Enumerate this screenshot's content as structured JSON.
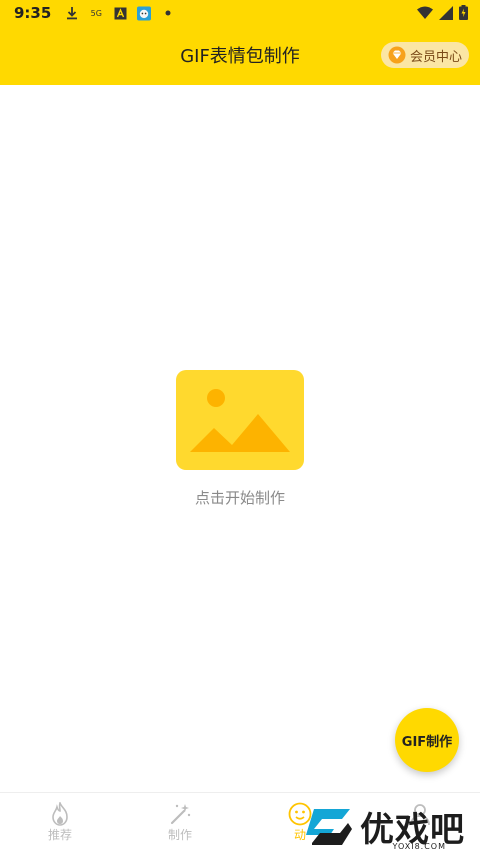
{
  "status_bar": {
    "time": "9:35",
    "network_label": "5G"
  },
  "header": {
    "title": "GIF表情包制作",
    "vip_label": "会员中心"
  },
  "empty_state": {
    "text": "点击开始制作"
  },
  "fab": {
    "label": "GIF制作"
  },
  "tabs": [
    {
      "label": "推荐",
      "icon": "flame-icon",
      "active": false
    },
    {
      "label": "制作",
      "icon": "magic-wand-icon",
      "active": false
    },
    {
      "label": "动",
      "icon": "emoji-face-icon",
      "active": true
    },
    {
      "label": "",
      "icon": "user-icon",
      "active": false
    }
  ],
  "watermark": {
    "text": "优戏吧",
    "sub": "YOXI8.COM"
  },
  "colors": {
    "brand_yellow": "#ffd900",
    "vip_bg": "#fbe6a4",
    "vip_text": "#7a4a17",
    "tab_active": "#ffc400",
    "tab_inactive": "#bdbdbd"
  }
}
